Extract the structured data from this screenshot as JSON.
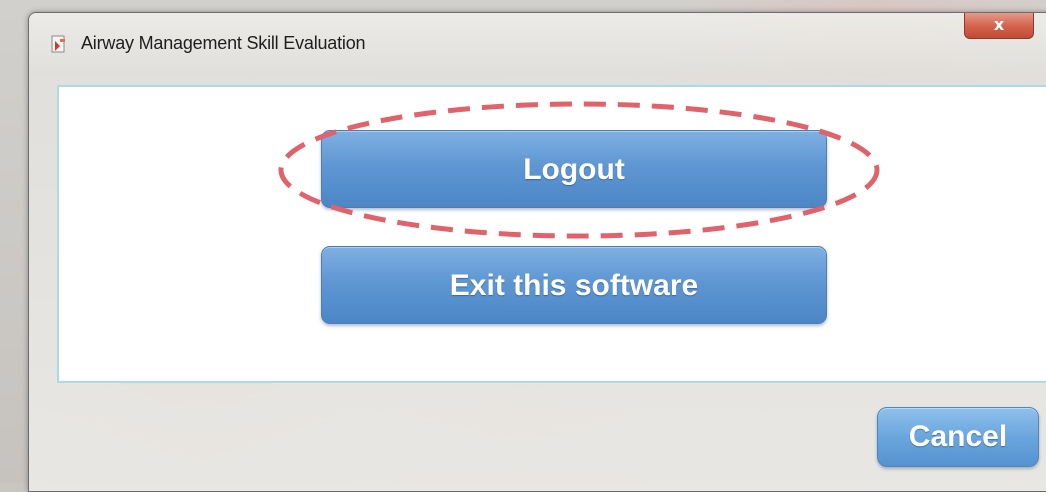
{
  "window": {
    "title": "Airway Management Skill Evaluation",
    "close_glyph": "x"
  },
  "dialog": {
    "logout_label": "Logout",
    "exit_label": "Exit this software",
    "cancel_label": "Cancel"
  },
  "annotation": {
    "highlight_color": "#e0626a",
    "highlighted_element": "logout-button"
  },
  "colors": {
    "button_blue": "#5f97d3",
    "frame_border": "#a8dde3",
    "close_red": "#d2614b"
  },
  "icons": {
    "app_icon": "app-icon",
    "close_icon": "close-icon"
  }
}
